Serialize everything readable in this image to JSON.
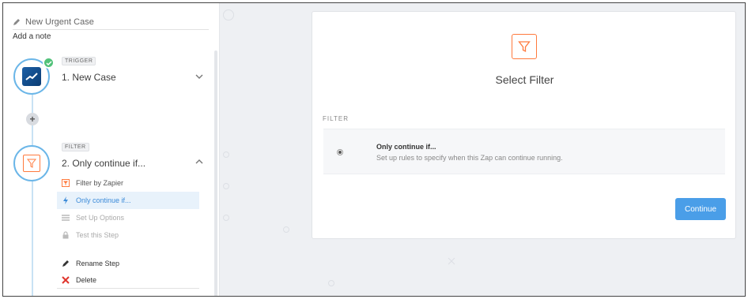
{
  "zap": {
    "title": "New Urgent Case",
    "add_note": "Add a note"
  },
  "steps": [
    {
      "tag": "TRIGGER",
      "name": "1. New Case",
      "expanded": false,
      "completed": true,
      "icon": "salesforce-logo-icon"
    },
    {
      "tag": "FILTER",
      "name": "2. Only continue if...",
      "expanded": true,
      "icon": "filter-icon",
      "sub_items": [
        {
          "label": "Filter by Zapier",
          "icon": "filter-icon",
          "state": "normal"
        },
        {
          "label": "Only continue if...",
          "icon": "bolt-icon",
          "state": "active"
        },
        {
          "label": "Set Up Options",
          "icon": "list-icon",
          "state": "disabled"
        },
        {
          "label": "Test this Step",
          "icon": "lock-icon",
          "state": "disabled"
        }
      ],
      "actions": [
        {
          "label": "Rename Step",
          "icon": "pencil-icon"
        },
        {
          "label": "Delete",
          "icon": "close-icon"
        }
      ]
    }
  ],
  "panel": {
    "title": "Select Filter",
    "section_label": "FILTER",
    "option": {
      "title": "Only continue if...",
      "description": "Set up rules to specify when this Zap can continue running.",
      "selected": true
    },
    "continue_label": "Continue"
  },
  "colors": {
    "accent_blue": "#4a9ee8",
    "filter_orange": "#ff7a3d",
    "success_green": "#52c27a",
    "delete_red": "#e0342c"
  }
}
